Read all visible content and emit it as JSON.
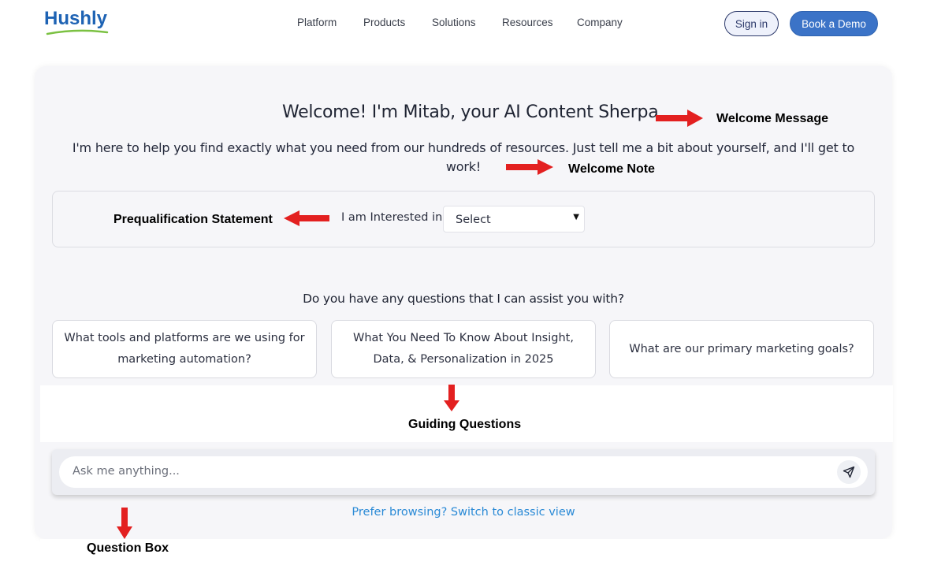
{
  "brand": {
    "name": "Hushly",
    "color": "#1e63b4",
    "swoosh_color": "#7bc142"
  },
  "nav": {
    "items": [
      "Platform",
      "Products",
      "Solutions",
      "Resources",
      "Company"
    ]
  },
  "header": {
    "signin_label": "Sign in",
    "demo_label": "Book a Demo"
  },
  "main": {
    "welcome_title": "Welcome! I'm Mitab, your AI Content Sherpa.",
    "welcome_note": "I'm here to help you find exactly what you need from our hundreds of resources. Just tell me a bit about yourself, and I'll get to work!",
    "prequal": {
      "label": "I am Interested in",
      "selected": "Select"
    },
    "questions_heading": "Do you have any questions that I can assist you with?",
    "questions": [
      "What tools and platforms are we using for marketing automation?",
      "What You Need To Know About Insight, Data, & Personalization in 2025",
      "What are our primary marketing goals?"
    ],
    "ask_placeholder": "Ask me anything...",
    "send_icon": "paper-plane-icon",
    "classic_link": "Prefer browsing? Switch to classic view"
  },
  "annotations": {
    "welcome_message": "Welcome Message",
    "welcome_note": "Welcome Note",
    "prequal_statement": "Prequalification Statement",
    "guiding_questions": "Guiding Questions",
    "question_box": "Question Box",
    "arrow_color": "#e32020"
  }
}
